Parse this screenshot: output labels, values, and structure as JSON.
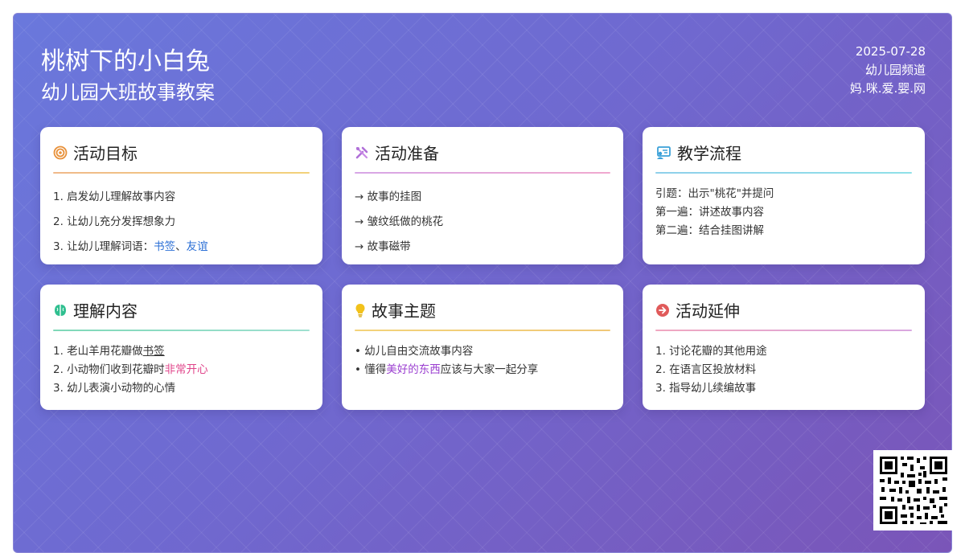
{
  "header": {
    "title": "桃树下的小白兔",
    "subtitle": "幼儿园大班故事教案",
    "date": "2025-07-28",
    "channel": "幼儿园频道",
    "site": "妈.咪.爱.婴.网"
  },
  "colors": {
    "goals_accent": "#e8913a",
    "prep_accent": "#b070d8",
    "flow_accent": "#3aa0d8",
    "understand_accent": "#2fbf8f",
    "theme_accent": "#f2c21b",
    "extend_accent": "#e05a5a"
  },
  "cards": {
    "goals": {
      "icon": "target-icon",
      "title": "活动目标",
      "items": [
        "1. 启发幼儿理解故事内容",
        "2. 让幼儿充分发挥想象力"
      ],
      "item3_prefix": "3. 让幼儿理解词语：",
      "item3_word1": "书签",
      "item3_sep": "、",
      "item3_word2": "友谊"
    },
    "prep": {
      "icon": "tools-icon",
      "title": "活动准备",
      "items": [
        "→ 故事的挂图",
        "→ 皱纹纸做的桃花",
        "→ 故事磁带"
      ]
    },
    "flow": {
      "icon": "presentation-icon",
      "title": "教学流程",
      "items": [
        "引题：出示\"桃花\"并提问",
        "第一遍：讲述故事内容",
        "第二遍：结合挂图讲解"
      ]
    },
    "understand": {
      "icon": "brain-icon",
      "title": "理解内容",
      "item1_prefix": "1. 老山羊用花瓣做",
      "item1_word": "书签",
      "item2_prefix": "2. 小动物们收到花瓣时",
      "item2_word": "非常开心",
      "item3": "3. 幼儿表演小动物的心情"
    },
    "theme": {
      "icon": "lightbulb-icon",
      "title": "故事主题",
      "item1": "• 幼儿自由交流故事内容",
      "item2_prefix": "• 懂得",
      "item2_word": "美好的东西",
      "item2_suffix": "应该与大家一起分享"
    },
    "extend": {
      "icon": "arrow-circle-icon",
      "title": "活动延伸",
      "items": [
        "1. 讨论花瓣的其他用途",
        "2. 在语言区投放材料",
        "3. 指导幼儿续编故事"
      ]
    }
  },
  "qr": {
    "icon": "qr-code-icon"
  }
}
